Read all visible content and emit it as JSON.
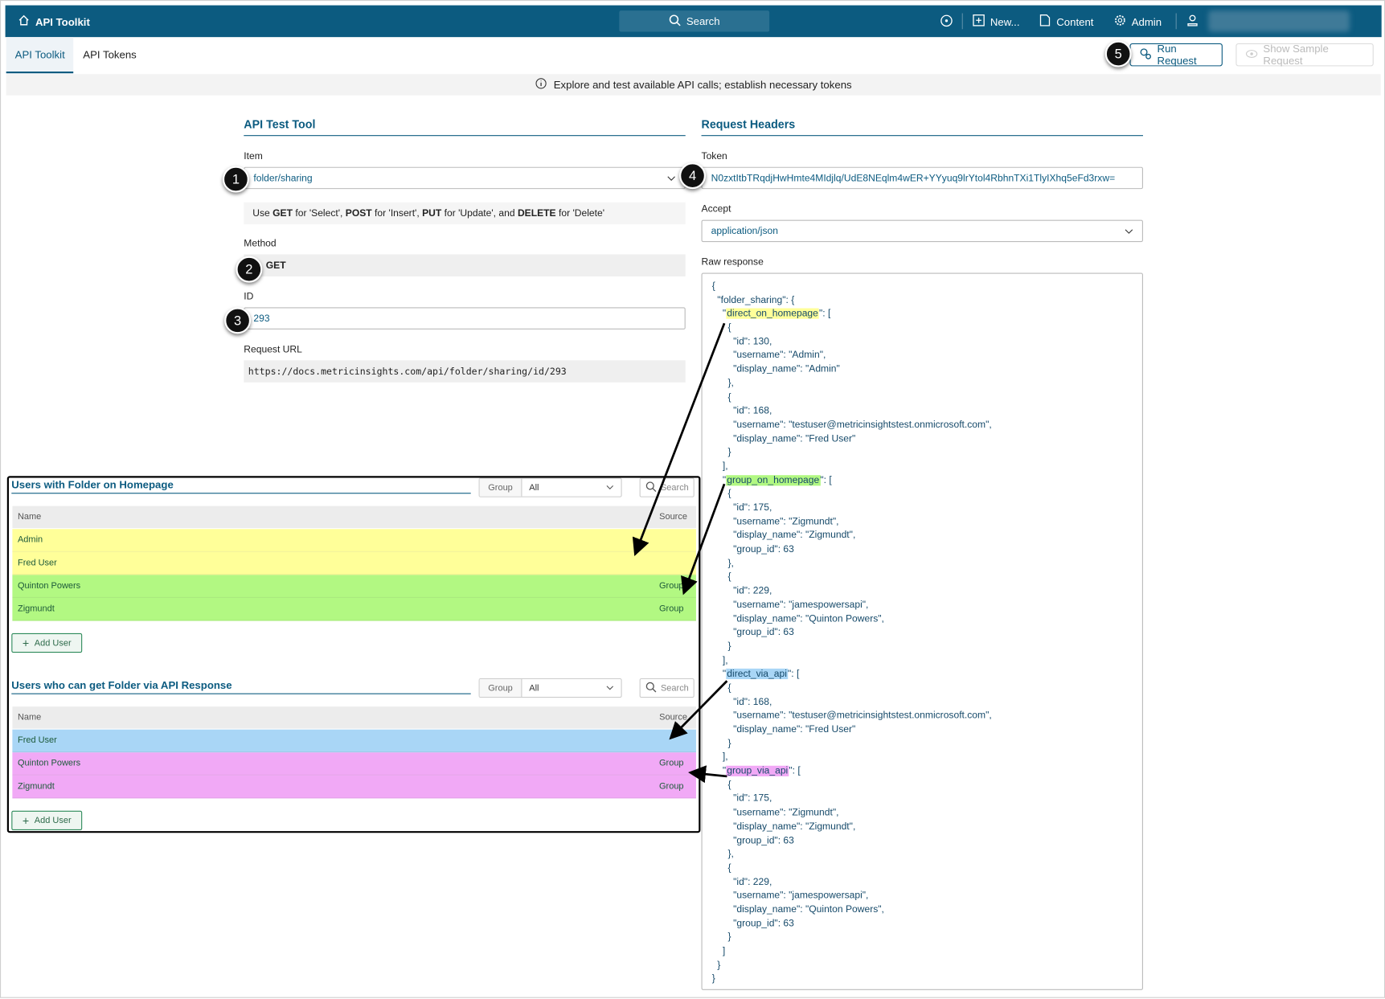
{
  "header": {
    "app_title": "API Toolkit",
    "search": "Search",
    "new": "New...",
    "content": "Content",
    "admin": "Admin"
  },
  "tabs": [
    {
      "label": "API Toolkit"
    },
    {
      "label": "API Tokens"
    }
  ],
  "toolbar": {
    "run_request": "Run Request",
    "show_sample": "Show Sample Request"
  },
  "info": "Explore and test available API calls; establish necessary tokens",
  "left": {
    "title": "API Test Tool",
    "item_label": "Item",
    "item_value": "folder/sharing",
    "hint": {
      "p1": "Use ",
      "b1": "GET",
      "p2": " for 'Select', ",
      "b2": "POST",
      "p3": " for 'Insert', ",
      "b3": "PUT",
      "p4": " for 'Update', and ",
      "b4": "DELETE",
      "p5": " for 'Delete'"
    },
    "method_label": "Method",
    "method_value": "GET",
    "id_label": "ID",
    "id_value": "293",
    "url_label": "Request URL",
    "url_value": "https://docs.metricinsights.com/api/folder/sharing/id/293"
  },
  "right": {
    "title": "Request Headers",
    "token_label": "Token",
    "token_value": "N0zxtItbTRqdjHwHmte4MIdjlq/UdE8NEqlm4wER+YYyuq9lrYtol4RbhnTXi1TlyIXhq5eFd3rxw=",
    "accept_label": "Accept",
    "accept_value": "application/json",
    "raw_label": "Raw response"
  },
  "badges": [
    "1",
    "2",
    "3",
    "4",
    "5"
  ],
  "colors": {
    "brand": "#0c5b80",
    "yellow": "#ffff99",
    "green": "#b2f882",
    "blue": "#a9d6f6",
    "pink": "#f1a9f6"
  },
  "raw_lines": [
    {
      "l": 0,
      "t": "{"
    },
    {
      "l": 1,
      "t": "\"folder_sharing\": {"
    },
    {
      "l": 2,
      "pre": "\"",
      "hl": "direct_on_homepage",
      "post": "\": [",
      "c": "yellow"
    },
    {
      "l": 3,
      "t": "{"
    },
    {
      "l": 4,
      "t": "\"id\": 130,"
    },
    {
      "l": 4,
      "t": "\"username\": \"Admin\","
    },
    {
      "l": 4,
      "t": "\"display_name\": \"Admin\""
    },
    {
      "l": 3,
      "t": "},"
    },
    {
      "l": 3,
      "t": "{"
    },
    {
      "l": 4,
      "t": "\"id\": 168,"
    },
    {
      "l": 4,
      "t": "\"username\": \"testuser@metricinsightstest.onmicrosoft.com\","
    },
    {
      "l": 4,
      "t": "\"display_name\": \"Fred User\""
    },
    {
      "l": 3,
      "t": "}"
    },
    {
      "l": 2,
      "t": "],"
    },
    {
      "l": 2,
      "pre": "\"",
      "hl": "group_on_homepage",
      "post": "\": [",
      "c": "green"
    },
    {
      "l": 3,
      "t": "{"
    },
    {
      "l": 4,
      "t": "\"id\": 175,"
    },
    {
      "l": 4,
      "t": "\"username\": \"Zigmundt\","
    },
    {
      "l": 4,
      "t": "\"display_name\": \"Zigmundt\","
    },
    {
      "l": 4,
      "t": "\"group_id\": 63"
    },
    {
      "l": 3,
      "t": "},"
    },
    {
      "l": 3,
      "t": "{"
    },
    {
      "l": 4,
      "t": "\"id\": 229,"
    },
    {
      "l": 4,
      "t": "\"username\": \"jamespowersapi\","
    },
    {
      "l": 4,
      "t": "\"display_name\": \"Quinton Powers\","
    },
    {
      "l": 4,
      "t": "\"group_id\": 63"
    },
    {
      "l": 3,
      "t": "}"
    },
    {
      "l": 2,
      "t": "],"
    },
    {
      "l": 2,
      "pre": "\"",
      "hl": "direct_via_api",
      "post": "\": [",
      "c": "blue"
    },
    {
      "l": 3,
      "t": "{"
    },
    {
      "l": 4,
      "t": "\"id\": 168,"
    },
    {
      "l": 4,
      "t": "\"username\": \"testuser@metricinsightstest.onmicrosoft.com\","
    },
    {
      "l": 4,
      "t": "\"display_name\": \"Fred User\""
    },
    {
      "l": 3,
      "t": "}"
    },
    {
      "l": 2,
      "t": "],"
    },
    {
      "l": 2,
      "pre": "\"",
      "hl": "group_via_api",
      "post": "\": [",
      "c": "pink"
    },
    {
      "l": 3,
      "t": "{"
    },
    {
      "l": 4,
      "t": "\"id\": 175,"
    },
    {
      "l": 4,
      "t": "\"username\": \"Zigmundt\","
    },
    {
      "l": 4,
      "t": "\"display_name\": \"Zigmundt\","
    },
    {
      "l": 4,
      "t": "\"group_id\": 63"
    },
    {
      "l": 3,
      "t": "},"
    },
    {
      "l": 3,
      "t": "{"
    },
    {
      "l": 4,
      "t": "\"id\": 229,"
    },
    {
      "l": 4,
      "t": "\"username\": \"jamespowersapi\","
    },
    {
      "l": 4,
      "t": "\"display_name\": \"Quinton Powers\","
    },
    {
      "l": 4,
      "t": "\"group_id\": 63"
    },
    {
      "l": 3,
      "t": "}"
    },
    {
      "l": 2,
      "t": "]"
    },
    {
      "l": 1,
      "t": "}"
    },
    {
      "l": 0,
      "t": "}"
    }
  ],
  "tables": [
    {
      "title": "Users with Folder on Homepage",
      "group_label": "Group",
      "group_value": "All",
      "search": "Search",
      "col_name": "Name",
      "col_source": "Source",
      "add_user": "Add User",
      "rows": [
        {
          "name": "Admin",
          "source": "",
          "c": "yellow"
        },
        {
          "name": "Fred User",
          "source": "",
          "c": "yellow"
        },
        {
          "name": "Quinton Powers",
          "source": "Group",
          "c": "green"
        },
        {
          "name": "Zigmundt",
          "source": "Group",
          "c": "green"
        }
      ]
    },
    {
      "title": "Users who can get Folder via API Response",
      "group_label": "Group",
      "group_value": "All",
      "search": "Search",
      "col_name": "Name",
      "col_source": "Source",
      "add_user": "Add User",
      "rows": [
        {
          "name": "Fred User",
          "source": "",
          "c": "blue"
        },
        {
          "name": "Quinton Powers",
          "source": "Group",
          "c": "pink"
        },
        {
          "name": "Zigmundt",
          "source": "Group",
          "c": "pink"
        }
      ]
    }
  ]
}
